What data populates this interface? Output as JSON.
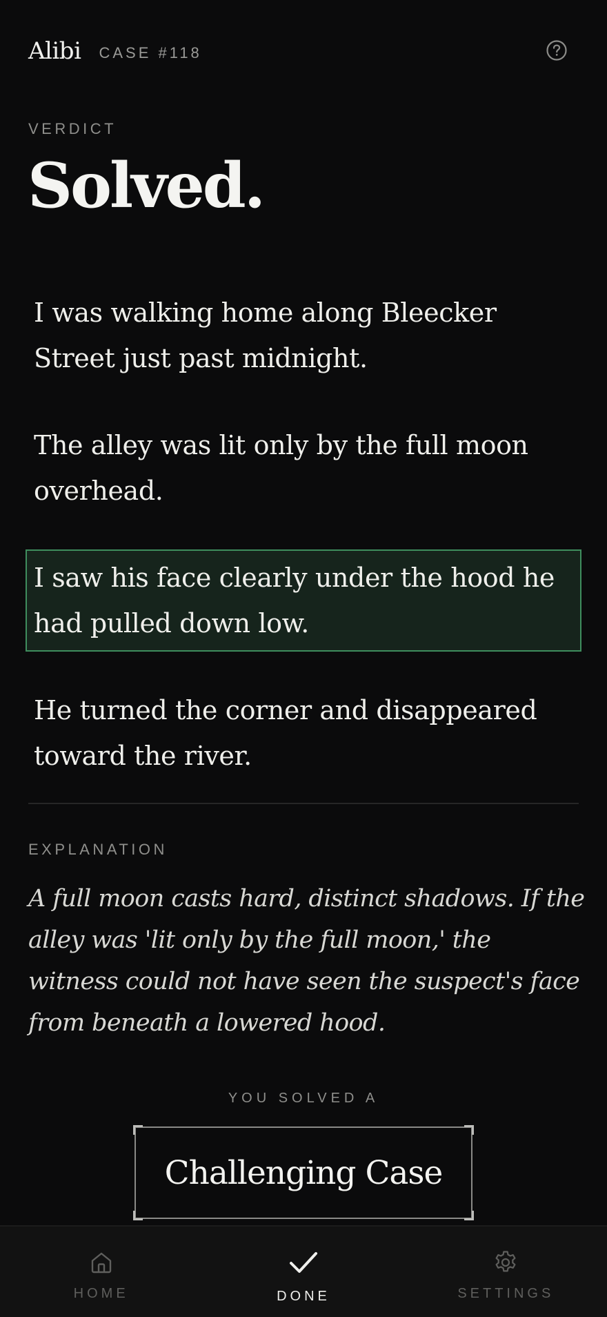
{
  "header": {
    "app_title": "Alibi",
    "case_id": "CASE #118",
    "help_icon": "question-circle-icon"
  },
  "verdict": {
    "label": "VERDICT",
    "title": "Solved."
  },
  "statements": [
    {
      "text": "I was walking home along Bleecker Street just past midnight.",
      "flagged": false
    },
    {
      "text": "The alley was lit only by the full moon overhead.",
      "flagged": false
    },
    {
      "text": "I saw his face clearly under the hood he had pulled down low.",
      "flagged": true
    },
    {
      "text": "He turned the corner and disappeared toward the river.",
      "flagged": false
    }
  ],
  "explanation": {
    "label": "EXPLANATION",
    "text": "A full moon casts hard, distinct shadows. If the alley was 'lit only by the full moon,' the witness could not have seen the suspect's face from beneath a lowered hood."
  },
  "result": {
    "caption": "YOU SOLVED A",
    "difficulty": "Challenging Case"
  },
  "tabbar": {
    "tabs": [
      {
        "label": "HOME",
        "icon": "home-icon",
        "active": false
      },
      {
        "label": "DONE",
        "icon": "checkmark-icon",
        "active": true
      },
      {
        "label": "SETTINGS",
        "icon": "gear-icon",
        "active": false
      }
    ]
  },
  "colors": {
    "background": "#0b0b0c",
    "flag_fill": "#16241c",
    "flag_border": "#3f8e5e"
  }
}
